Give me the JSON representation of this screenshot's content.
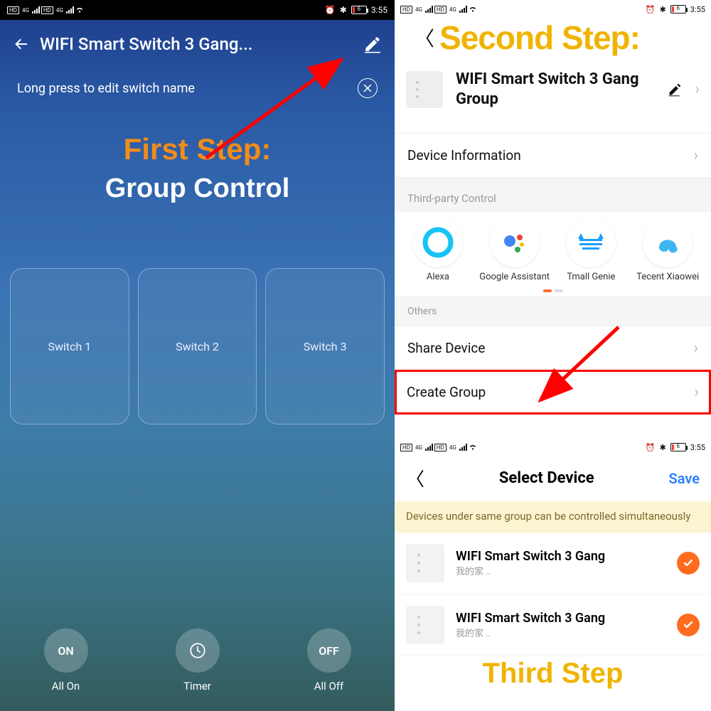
{
  "status": {
    "time": "3:55",
    "battery": "6"
  },
  "left": {
    "title": "WIFI Smart Switch 3 Gang...",
    "hint": "Long press to edit switch name",
    "step_label": "First Step:",
    "step_sub": "Group Control",
    "switches": [
      "Switch 1",
      "Switch 2",
      "Switch 3"
    ],
    "bottom": {
      "on": "ON",
      "on_label": "All On",
      "timer_label": "Timer",
      "off": "OFF",
      "off_label": "All Off"
    }
  },
  "right": {
    "step_label": "Second Step:",
    "device_name": "WIFI Smart Switch 3 Gang Group",
    "rows": {
      "device_info": "Device Information",
      "third_party_hdr": "Third-party Control",
      "others_hdr": "Others",
      "share_device": "Share Device",
      "create_group": "Create Group"
    },
    "third_party": [
      {
        "name": "Alexa"
      },
      {
        "name": "Google Assistant"
      },
      {
        "name": "Tmall Genie"
      },
      {
        "name": "Tecent Xiaowei"
      }
    ]
  },
  "third": {
    "title": "Select Device",
    "save": "Save",
    "note": "Devices under same group can be controlled simultaneously",
    "device_name": "WIFI Smart Switch 3 Gang",
    "device_sub": "我的家 ..",
    "step_label": "Third Step"
  }
}
